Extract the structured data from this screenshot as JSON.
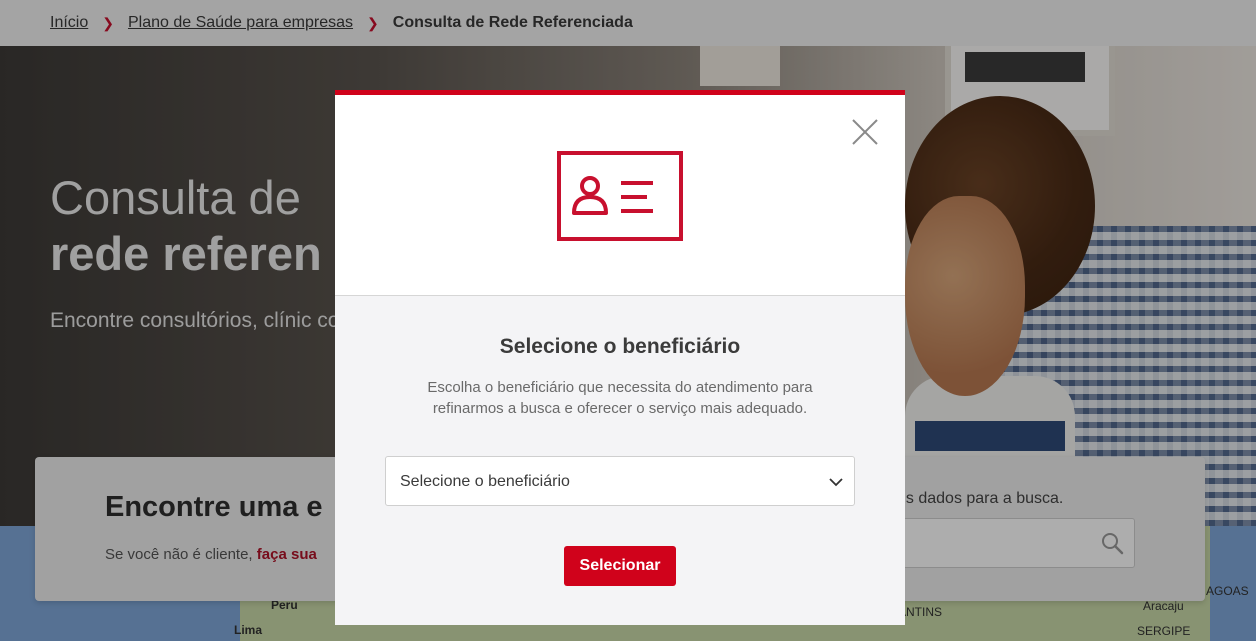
{
  "breadcrumb": {
    "items": [
      "Início",
      "Plano de Saúde para empresas"
    ],
    "current": "Consulta de Rede Referenciada"
  },
  "hero": {
    "title_line1": "Consulta de",
    "title_line2": "rede referen",
    "subtitle": "Encontre consultórios, clínic com médicos de várias espe"
  },
  "search_card": {
    "heading": "Encontre uma e",
    "note_prefix": "Se você não é cliente,",
    "note_link": "faça sua",
    "right_label": "us dados para a busca."
  },
  "map": {
    "labels": [
      "Peru",
      "Lima",
      "ANTINS",
      "Aracaju",
      "SERGIPE",
      "AGOAS"
    ]
  },
  "modal": {
    "title": "Selecione o beneficiário",
    "description": "Escolha o beneficiário que necessita do atendimento para refinarmos a busca e oferecer o serviço mais adequado.",
    "select_placeholder": "Selecione o beneficiário",
    "button_label": "Selecionar"
  },
  "colors": {
    "accent": "#d0021b",
    "link": "#b0142a"
  },
  "icons": [
    "close-icon",
    "id-card-icon",
    "chevron-down-icon",
    "search-icon",
    "chevron-right-icon"
  ]
}
